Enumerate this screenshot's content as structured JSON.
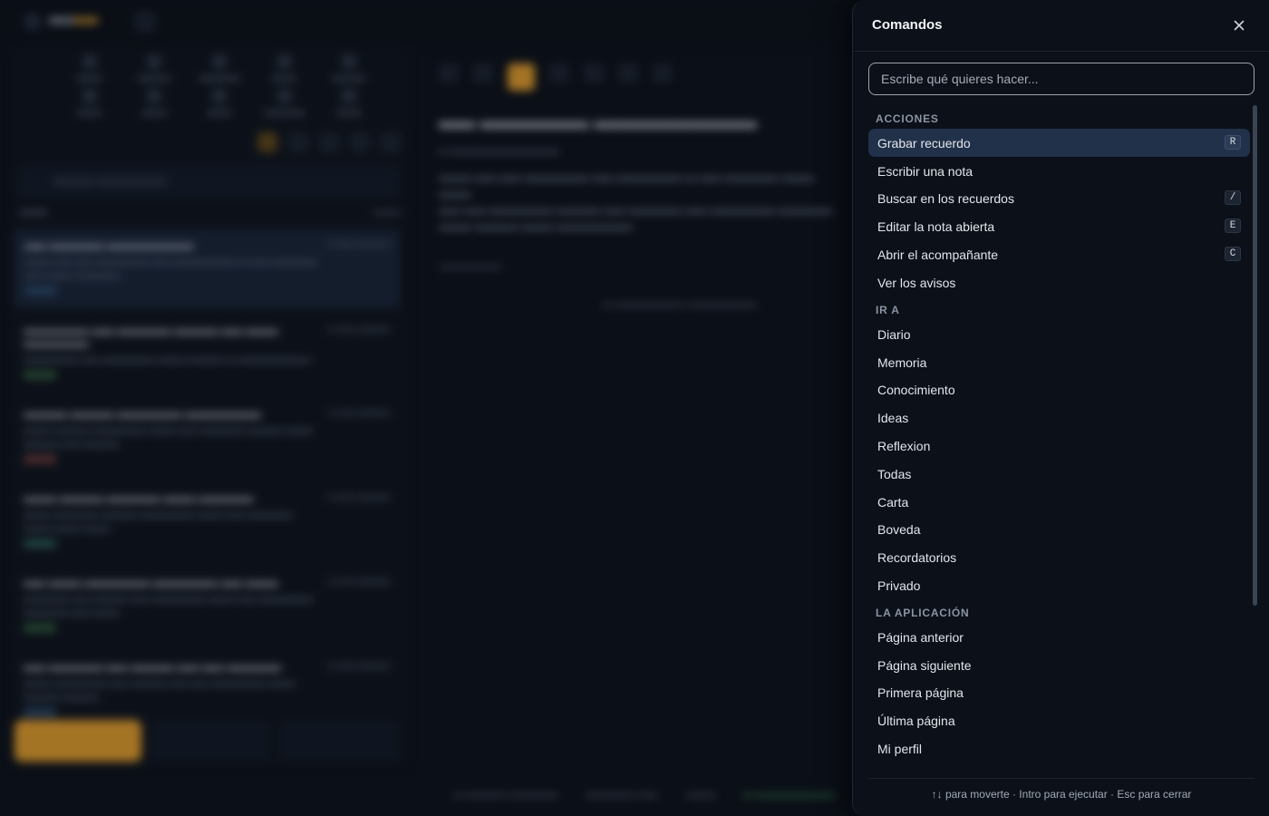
{
  "palette": {
    "title": "Comandos",
    "search_placeholder": "Escribe qué quieres hacer...",
    "groups": {
      "acciones": {
        "label": "ACCIONES",
        "items": [
          {
            "label": "Grabar recuerdo",
            "shortcut": "R"
          },
          {
            "label": "Escribir una nota",
            "shortcut": ""
          },
          {
            "label": "Buscar en los recuerdos",
            "shortcut": "/"
          },
          {
            "label": "Editar la nota abierta",
            "shortcut": "E"
          },
          {
            "label": "Abrir el acompañante",
            "shortcut": "C"
          },
          {
            "label": "Ver los avisos",
            "shortcut": ""
          }
        ]
      },
      "ir_a": {
        "label": "IR A",
        "items": [
          {
            "label": "Diario"
          },
          {
            "label": "Memoria"
          },
          {
            "label": "Conocimiento"
          },
          {
            "label": "Ideas"
          },
          {
            "label": "Reflexion"
          },
          {
            "label": "Todas"
          },
          {
            "label": "Carta"
          },
          {
            "label": "Boveda"
          },
          {
            "label": "Recordatorios"
          },
          {
            "label": "Privado"
          }
        ]
      },
      "la_aplicacion": {
        "label": "LA APLICACIÓN",
        "items": [
          {
            "label": "Página anterior"
          },
          {
            "label": "Página siguiente"
          },
          {
            "label": "Primera página"
          },
          {
            "label": "Última página"
          },
          {
            "label": "Mi perfil"
          }
        ]
      }
    },
    "footer_hint": "↑↓ para moverte · Intro para ejecutar · Esc para cerrar"
  },
  "colors": {
    "accent": "#d8962a",
    "active_item_bg": "#22314a",
    "panel_bg": "#0b1019"
  }
}
